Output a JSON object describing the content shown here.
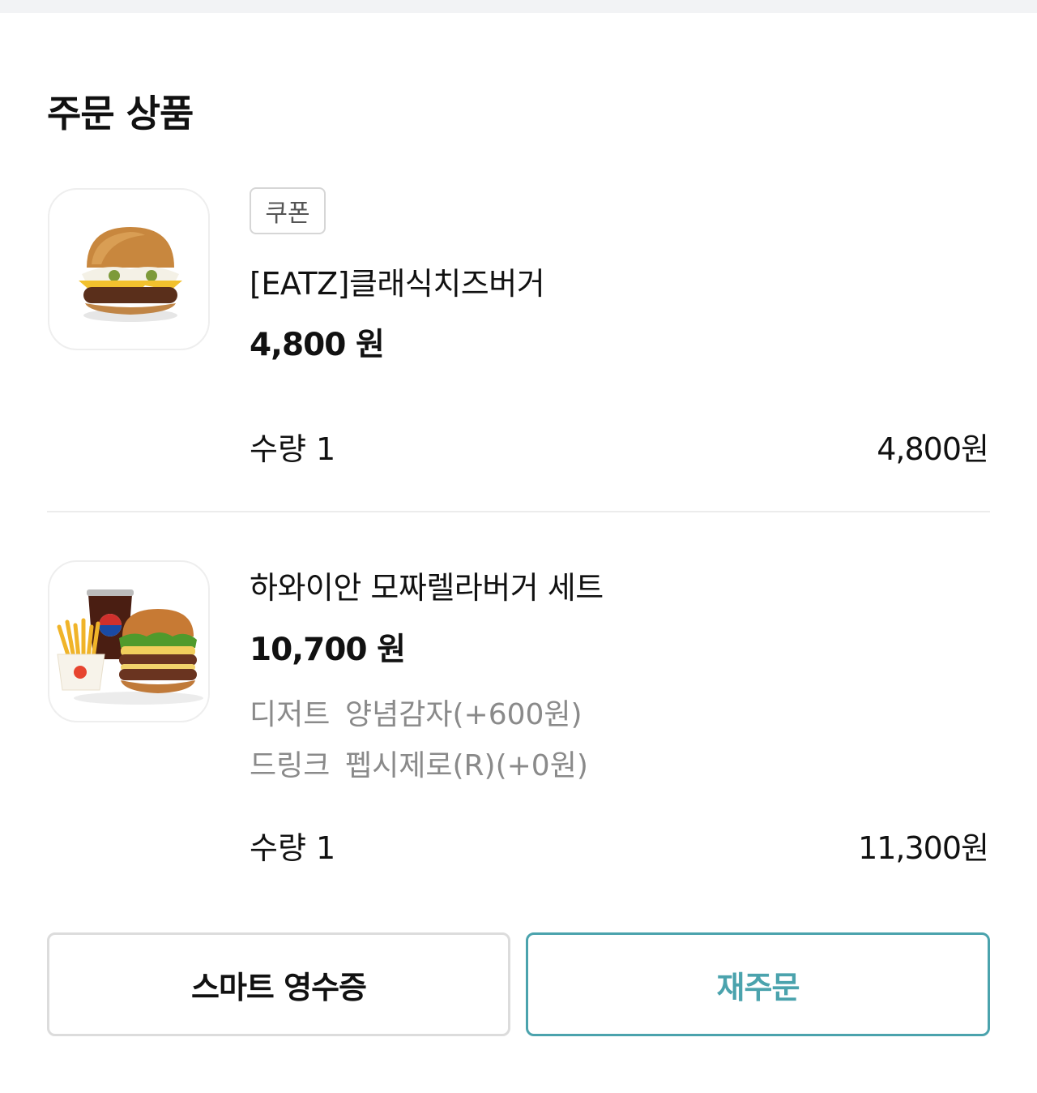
{
  "section_title": "주문 상품",
  "items": [
    {
      "badge": "쿠폰",
      "name": "[EATZ]클래식치즈버거",
      "price": "4,800 원",
      "quantity": "수량 1",
      "total": "4,800원",
      "image_icon": "cheeseburger-image"
    },
    {
      "name": "하와이안 모짜렐라버거 세트",
      "price": "10,700 원",
      "options": [
        {
          "label": "디저트",
          "value": "양념감자(+600원)"
        },
        {
          "label": "드링크",
          "value": "펩시제로(R)(+0원)"
        }
      ],
      "quantity": "수량 1",
      "total": "11,300원",
      "image_icon": "burger-set-image"
    }
  ],
  "buttons": {
    "receipt": "스마트 영수증",
    "reorder": "재주문"
  },
  "colors": {
    "accent": "#4ba3ad",
    "divider": "#ececec",
    "muted_text": "#8a8a8a"
  }
}
